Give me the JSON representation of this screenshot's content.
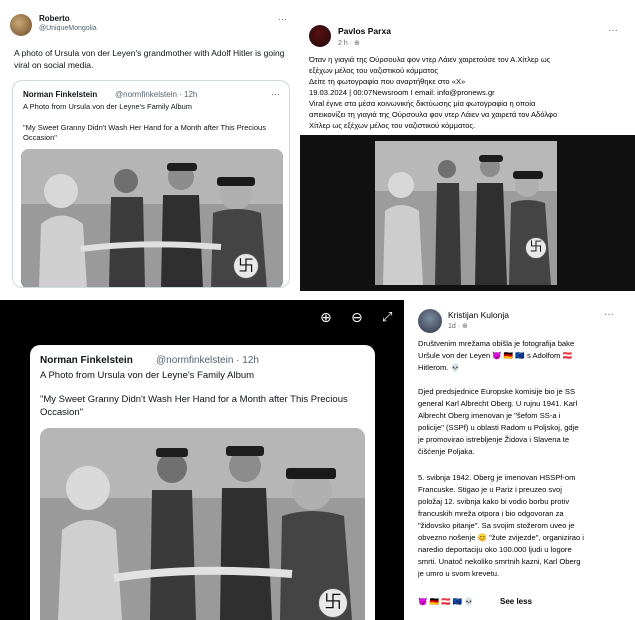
{
  "panel1": {
    "author_name": "Roberto",
    "author_handle": "@UniqueMongolia",
    "text_line1": "A photo of Ursula von der Leyen's grandmother with Adolf Hitler is going",
    "text_line2": "viral on social media.",
    "more": "···",
    "quoted": {
      "author_name": "Norman Finkelstein",
      "author_handle": "@normfinkelstein · 12h",
      "subtitle": "A Photo from Ursula von der Leyne's Family Album",
      "caption_line1": "\"My Sweet Granny Didn't Wash Her Hand for a Month after This Precious",
      "caption_line2": "Occasion\"",
      "more": "···"
    }
  },
  "panel2": {
    "author_name": "Pavlos Parxa",
    "time": "2 h · ⊕",
    "more": "···",
    "lines": [
      "Όταν η γιαγιά της Ούρσουλα φον ντερ Λάιεν χαιρετούσε τον Α.Χίτλερ ως",
      "εξέχων μέλος του ναζιστικού κόμματος",
      "Δείτε τη φωτογραφία που αναρτήθηκε στο «X»",
      "19.03.2024 | 00:07Newsroom I email: info@pronews.gr",
      "Viral έγινε στα μέσα κοινωνικής δικτύωσης μία φωτογραφία η οποία",
      "απεικονίζει τη γιαγιά της Ούρσουλα φον ντερ Λάιεν να χαιρετά τον Αδόλφο",
      "Χίτλερ ως εξέχων μέλος του ναζιστικού κόμματος."
    ]
  },
  "panel3": {
    "author_name": "Norman Finkelstein",
    "author_handle": "@normfinkelstein · 12h",
    "subtitle": "A Photo from Ursula von der Leyne's Family Album",
    "caption_line1": "\"My Sweet Granny Didn't Wash Her Hand for a Month after This Precious",
    "caption_line2": "Occasion\"",
    "zoom_in_icon": "⊕",
    "zoom_out_icon": "⊖",
    "expand_icon": "⤢"
  },
  "panel4": {
    "author_name": "Kristijan Kulonja",
    "time": "1d · ⊕",
    "more": "···",
    "para1": [
      "Društvenim mrežama obišla je fotografija bake",
      "Uršule von der Leyen 😈 🇩🇪 🇪🇺 s Adolfom 🇦🇹",
      "Hitlerom. 💀"
    ],
    "para2": [
      "Djed predsjednice Europske komisije bio je SS",
      "general Karl Albrecht Oberg. U rujnu 1941. Karl",
      "Albrecht Oberg imenovan je \"šefom SS-a i",
      "policije\" (SSPf) u oblasti Radom u Poljskoj, gdje",
      "je promovirao istrebljenje Židova i Slavena te",
      "čišćenje Poljaka."
    ],
    "para3": [
      "5. svibnja 1942. Oberg je imenovan HSSPf-om",
      "Francuske. Stigao je u Pariz i preuzeo svoj",
      "položaj 12. svibnja kako bi vodio borbu protiv",
      "francuskih mreža otpora i bio odgovoran za",
      "\"židovsko pitanje\". Sa svojim stožerom uveo je",
      "obvezno nošenje 😊 \"žute zvijezde\", organizirao i",
      "naredio deportaciju oko 100.000 ljudi u logore",
      "smrti. Unatoč nekoliko smrtnih kazni, Karl Oberg",
      "je umro u svom krevetu."
    ],
    "footer_emoji": "😈 🇩🇪 🇦🇹 🇪🇺 💀",
    "see_less": "See less"
  },
  "colors": {
    "text": "#0f1419",
    "muted": "#536471",
    "facebook_text": "#050505",
    "dark_panel": "#000000"
  }
}
